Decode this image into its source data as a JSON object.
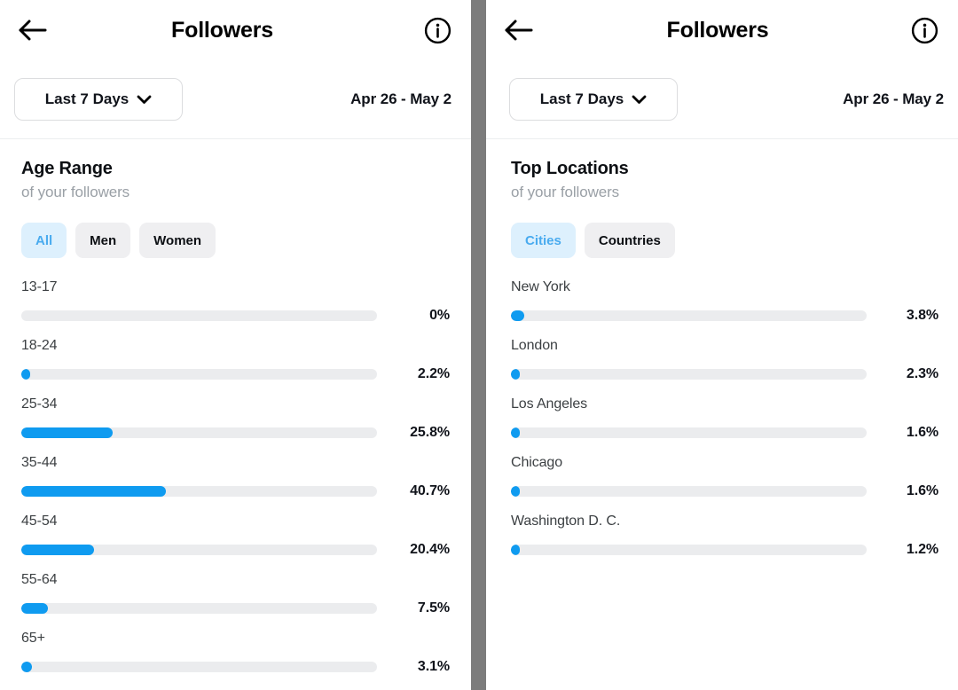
{
  "colors": {
    "accent_blue": "#0f9bf0",
    "chip_selected_bg": "#ddf0fd",
    "chip_selected_text": "#49abef",
    "chip_bg": "#efeff1",
    "track": "#ebecee",
    "divider": "#7c7c7c",
    "text_primary": "#10131a",
    "text_secondary": "#9aa0a6"
  },
  "left_panel": {
    "nav": {
      "back_icon": "arrow-left-icon",
      "title": "Followers",
      "info_icon": "info-circle-icon"
    },
    "range_button": {
      "label": "Last 7 Days",
      "chevron_icon": "chevron-down-icon"
    },
    "date_range": "Apr 26 - May 2",
    "section": {
      "title": "Age Range",
      "subtitle": "of your followers"
    },
    "chips": [
      {
        "label": "All",
        "selected": true
      },
      {
        "label": "Men",
        "selected": false
      },
      {
        "label": "Women",
        "selected": false
      }
    ],
    "chart_data": {
      "type": "bar",
      "title": "Age Range",
      "subtitle": "of your followers",
      "orientation": "horizontal",
      "xlabel": "",
      "ylabel": "",
      "xlim": [
        0,
        100
      ],
      "grid": false,
      "legend": false,
      "unit": "%",
      "categories": [
        "13-17",
        "18-24",
        "25-34",
        "35-44",
        "45-54",
        "55-64",
        "65+"
      ],
      "values": [
        0,
        2.2,
        25.8,
        40.7,
        20.4,
        7.5,
        3.1
      ],
      "labels": [
        "0%",
        "2.2%",
        "25.8%",
        "40.7%",
        "20.4%",
        "7.5%",
        "3.1%"
      ]
    }
  },
  "right_panel": {
    "nav": {
      "back_icon": "arrow-left-icon",
      "title": "Followers",
      "info_icon": "info-circle-icon"
    },
    "range_button": {
      "label": "Last 7 Days",
      "chevron_icon": "chevron-down-icon"
    },
    "date_range": "Apr 26 - May 2",
    "section": {
      "title": "Top Locations",
      "subtitle": "of your followers"
    },
    "chips": [
      {
        "label": "Cities",
        "selected": true
      },
      {
        "label": "Countries",
        "selected": false
      }
    ],
    "chart_data": {
      "type": "bar",
      "title": "Top Locations",
      "subtitle": "of your followers",
      "orientation": "horizontal",
      "xlabel": "",
      "ylabel": "",
      "xlim": [
        0,
        100
      ],
      "grid": false,
      "legend": false,
      "unit": "%",
      "categories": [
        "New York",
        "London",
        "Los Angeles",
        "Chicago",
        "Washington D. C."
      ],
      "values": [
        3.8,
        2.3,
        1.6,
        1.6,
        1.2
      ],
      "labels": [
        "3.8%",
        "2.3%",
        "1.6%",
        "1.6%",
        "1.2%"
      ]
    }
  }
}
